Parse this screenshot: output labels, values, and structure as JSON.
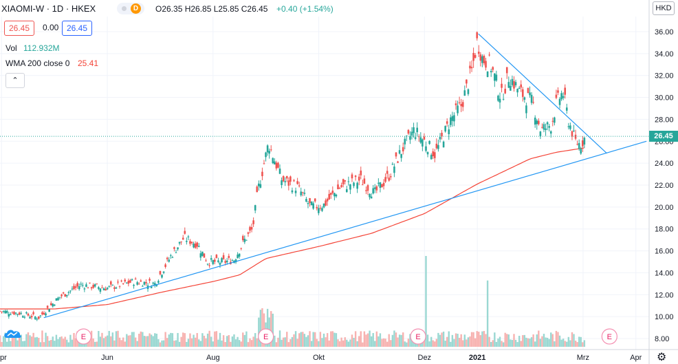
{
  "header": {
    "symbol": "XIAOMI-W · 1D · HKEX",
    "ohlc": "O26.35 H26.85 L25.85 C26.45",
    "change": "+0.40 (+1.54%)",
    "badge_letter": "D",
    "currency": "HKD"
  },
  "legend": {
    "bid": "26.45",
    "spread": "0.00",
    "ask": "26.45",
    "vol_label": "Vol",
    "vol_value": "112.932M",
    "wma_label": "WMA 200 close 0",
    "wma_value": "25.41"
  },
  "colors": {
    "up": "#26a69a",
    "down": "#ef5350",
    "wma": "#f44336",
    "trendline": "#2196f3",
    "volume_up": "#9ad8d2",
    "volume_down": "#f7b2b0",
    "text": "#131722",
    "grid": "#f0f3fa"
  },
  "icons": {
    "collapse": "chevron-up-icon",
    "logo": "tradingview-cloud-icon",
    "settings": "gear-icon"
  },
  "chart_data": {
    "type": "candlestick",
    "last_price": "26.45",
    "y_ticks": [
      "36.00",
      "34.00",
      "32.00",
      "30.00",
      "28.00",
      "26.00",
      "24.00",
      "22.00",
      "20.00",
      "18.00",
      "16.00",
      "14.00",
      "12.00",
      "10.00",
      "8.00"
    ],
    "ylim": [
      7.7,
      37.7
    ],
    "x_tick_labels": [
      {
        "label": "pr",
        "month": 4
      },
      {
        "label": "Jun",
        "month": 6
      },
      {
        "label": "Aug",
        "month": 8
      },
      {
        "label": "Okt",
        "month": 10
      },
      {
        "label": "Dez",
        "month": 12
      },
      {
        "label": "2021",
        "month": 13
      },
      {
        "label": "Mrz",
        "month": 15
      },
      {
        "label": "Apr",
        "month": 16
      }
    ],
    "xlim_months": [
      3.97,
      16.25
    ],
    "price_anchors": [
      {
        "m": 3.97,
        "p": 10.5
      },
      {
        "m": 4.35,
        "p": 10.3
      },
      {
        "m": 4.7,
        "p": 9.9
      },
      {
        "m": 5.1,
        "p": 11.8
      },
      {
        "m": 5.5,
        "p": 12.9
      },
      {
        "m": 6.0,
        "p": 12.6
      },
      {
        "m": 6.5,
        "p": 13.2
      },
      {
        "m": 6.9,
        "p": 13.0
      },
      {
        "m": 7.2,
        "p": 15.5
      },
      {
        "m": 7.45,
        "p": 17.2
      },
      {
        "m": 7.7,
        "p": 16.6
      },
      {
        "m": 7.9,
        "p": 15.0
      },
      {
        "m": 8.2,
        "p": 15.0
      },
      {
        "m": 8.4,
        "p": 15.2
      },
      {
        "m": 8.6,
        "p": 17.0
      },
      {
        "m": 8.75,
        "p": 18.0
      },
      {
        "m": 8.85,
        "p": 21.5
      },
      {
        "m": 9.05,
        "p": 25.8
      },
      {
        "m": 9.3,
        "p": 22.5
      },
      {
        "m": 9.6,
        "p": 21.8
      },
      {
        "m": 9.85,
        "p": 20.0
      },
      {
        "m": 10.1,
        "p": 20.2
      },
      {
        "m": 10.4,
        "p": 21.8
      },
      {
        "m": 10.8,
        "p": 22.5
      },
      {
        "m": 11.05,
        "p": 21.2
      },
      {
        "m": 11.35,
        "p": 23.0
      },
      {
        "m": 11.55,
        "p": 25.0
      },
      {
        "m": 11.8,
        "p": 27.0
      },
      {
        "m": 12.0,
        "p": 26.0
      },
      {
        "m": 12.2,
        "p": 24.8
      },
      {
        "m": 12.5,
        "p": 28.0
      },
      {
        "m": 12.7,
        "p": 29.3
      },
      {
        "m": 12.9,
        "p": 32.5
      },
      {
        "m": 13.0,
        "p": 35.2
      },
      {
        "m": 13.1,
        "p": 33.5
      },
      {
        "m": 13.25,
        "p": 33.0
      },
      {
        "m": 13.45,
        "p": 30.0
      },
      {
        "m": 13.6,
        "p": 32.0
      },
      {
        "m": 13.8,
        "p": 30.5
      },
      {
        "m": 14.05,
        "p": 29.5
      },
      {
        "m": 14.2,
        "p": 27.0
      },
      {
        "m": 14.4,
        "p": 27.5
      },
      {
        "m": 14.5,
        "p": 29.5
      },
      {
        "m": 14.62,
        "p": 30.5
      },
      {
        "m": 14.72,
        "p": 28.0
      },
      {
        "m": 14.85,
        "p": 26.0
      },
      {
        "m": 14.95,
        "p": 25.7
      },
      {
        "m": 15.05,
        "p": 26.45
      }
    ],
    "candle_start_month": 3.97,
    "candle_end_month": 15.05,
    "candle_step_month": 0.0333,
    "wma_anchors": [
      {
        "m": 3.97,
        "p": 10.7
      },
      {
        "m": 5.0,
        "p": 10.7
      },
      {
        "m": 6.0,
        "p": 11.1
      },
      {
        "m": 7.0,
        "p": 12.2
      },
      {
        "m": 8.0,
        "p": 13.2
      },
      {
        "m": 8.5,
        "p": 13.8
      },
      {
        "m": 9.0,
        "p": 15.3
      },
      {
        "m": 10.0,
        "p": 16.4
      },
      {
        "m": 11.0,
        "p": 17.6
      },
      {
        "m": 12.0,
        "p": 19.4
      },
      {
        "m": 13.0,
        "p": 22.1
      },
      {
        "m": 14.0,
        "p": 24.4
      },
      {
        "m": 14.5,
        "p": 25.0
      },
      {
        "m": 15.05,
        "p": 25.41
      }
    ],
    "trendlines": [
      {
        "name": "support",
        "from": {
          "m": 4.8,
          "p": 9.9
        },
        "to": {
          "m": 16.2,
          "p": 26.0
        }
      },
      {
        "name": "resistance",
        "from": {
          "m": 13.02,
          "p": 35.8
        },
        "to": {
          "m": 15.45,
          "p": 24.9
        }
      }
    ],
    "volume": {
      "max_label_free": true,
      "spikes": [
        {
          "m": 12.02,
          "h": 1.0,
          "up": true
        },
        {
          "m": 13.2,
          "h": 0.73,
          "up": true
        }
      ],
      "base_level": 0.12
    },
    "earnings_markers": [
      {
        "m": 5.55,
        "label": "E"
      },
      {
        "m": 9.0,
        "label": "E"
      },
      {
        "m": 11.88,
        "label": "E"
      },
      {
        "m": 15.5,
        "label": "E"
      }
    ]
  }
}
